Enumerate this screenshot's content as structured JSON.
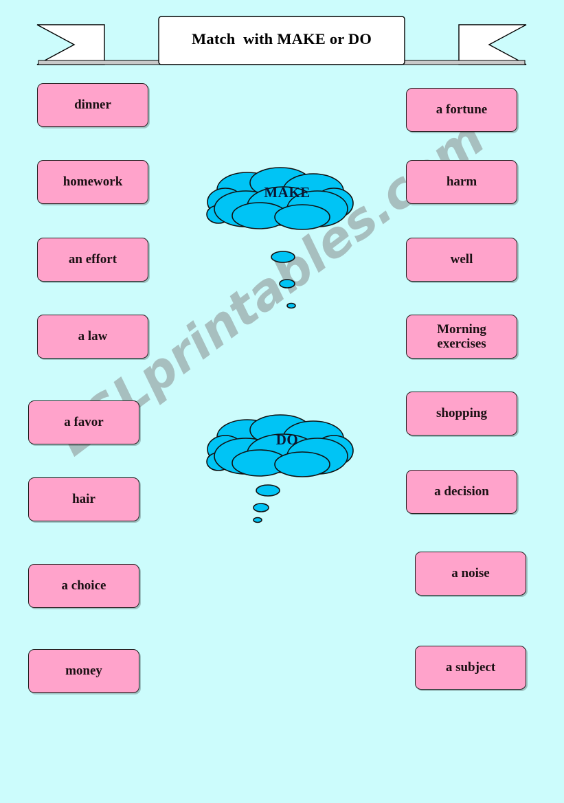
{
  "page": {
    "background_color": "#ccfcfc",
    "card_color": "#ffa3cb",
    "cloud_color": "#00c4f5",
    "border_color": "#231f20",
    "watermark_color": "#9aa8a8"
  },
  "header": {
    "title": "Match  with MAKE or DO"
  },
  "watermark": {
    "text": "ESLprintables.com"
  },
  "clouds": [
    {
      "label": "MAKE"
    },
    {
      "label": "DO"
    }
  ],
  "left_column": {
    "items": [
      {
        "label": "dinner"
      },
      {
        "label": "homework"
      },
      {
        "label": "an effort"
      },
      {
        "label": "a law"
      },
      {
        "label": "a favor"
      },
      {
        "label": "hair"
      },
      {
        "label": "a choice"
      },
      {
        "label": "money"
      }
    ]
  },
  "right_column": {
    "items": [
      {
        "label": "a fortune"
      },
      {
        "label": "harm"
      },
      {
        "label": "well"
      },
      {
        "label": "Morning\nexercises"
      },
      {
        "label": "shopping"
      },
      {
        "label": "a decision"
      },
      {
        "label": "a noise"
      },
      {
        "label": "a subject"
      }
    ]
  }
}
